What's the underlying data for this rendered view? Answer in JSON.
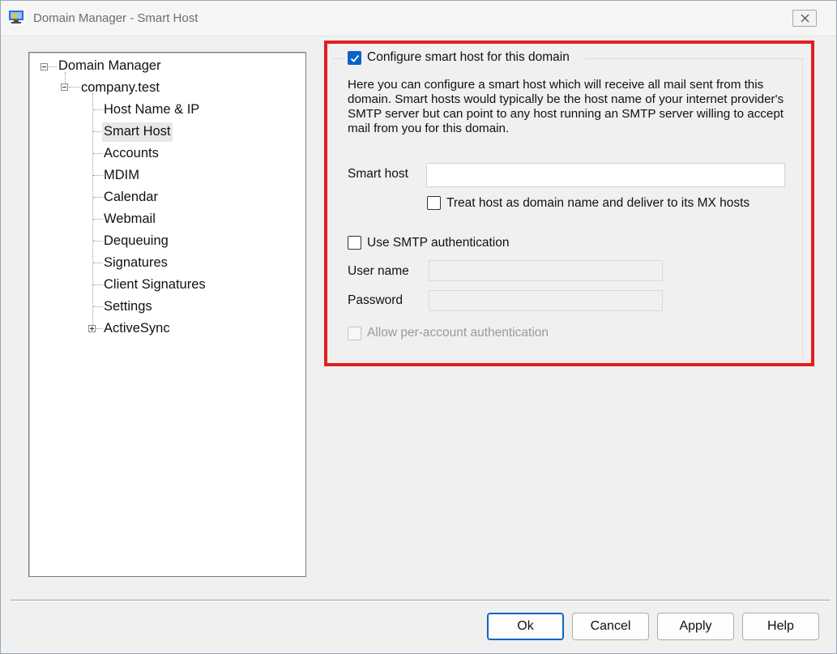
{
  "window": {
    "title": "Domain Manager - Smart Host",
    "app_icon": "domain-manager-app-icon",
    "close_icon": "close-icon"
  },
  "tree": {
    "root": {
      "label": "Domain Manager",
      "expanded": true
    },
    "domain": {
      "label": "company.test",
      "expanded": true
    },
    "items": [
      {
        "label": "Host Name & IP"
      },
      {
        "label": "Smart Host",
        "selected": true
      },
      {
        "label": "Accounts"
      },
      {
        "label": "MDIM"
      },
      {
        "label": "Calendar"
      },
      {
        "label": "Webmail"
      },
      {
        "label": "Dequeuing"
      },
      {
        "label": "Signatures"
      },
      {
        "label": "Client Signatures"
      },
      {
        "label": "Settings"
      },
      {
        "label": "ActiveSync",
        "expandable": true
      }
    ]
  },
  "smart_host": {
    "configure_label": "Configure smart host for this domain",
    "configure_checked": true,
    "description": "Here you can configure a smart host which will receive all mail sent from this domain.  Smart hosts would typically be the host name of your internet provider's SMTP server but can point to any host running an SMTP server willing to accept mail from you for this domain.",
    "smart_host_label": "Smart host",
    "smart_host_value": "",
    "treat_mx_label": "Treat host as domain name and deliver to its MX hosts",
    "treat_mx_checked": false,
    "use_auth_label": "Use SMTP authentication",
    "use_auth_checked": false,
    "username_label": "User name",
    "username_value": "",
    "password_label": "Password",
    "password_value": "",
    "per_account_label": "Allow per-account authentication",
    "per_account_checked": false,
    "per_account_disabled": true
  },
  "buttons": {
    "ok": "Ok",
    "cancel": "Cancel",
    "apply": "Apply",
    "help": "Help"
  },
  "colors": {
    "accent": "#0a64c6",
    "highlight_frame": "#e21f1f"
  }
}
